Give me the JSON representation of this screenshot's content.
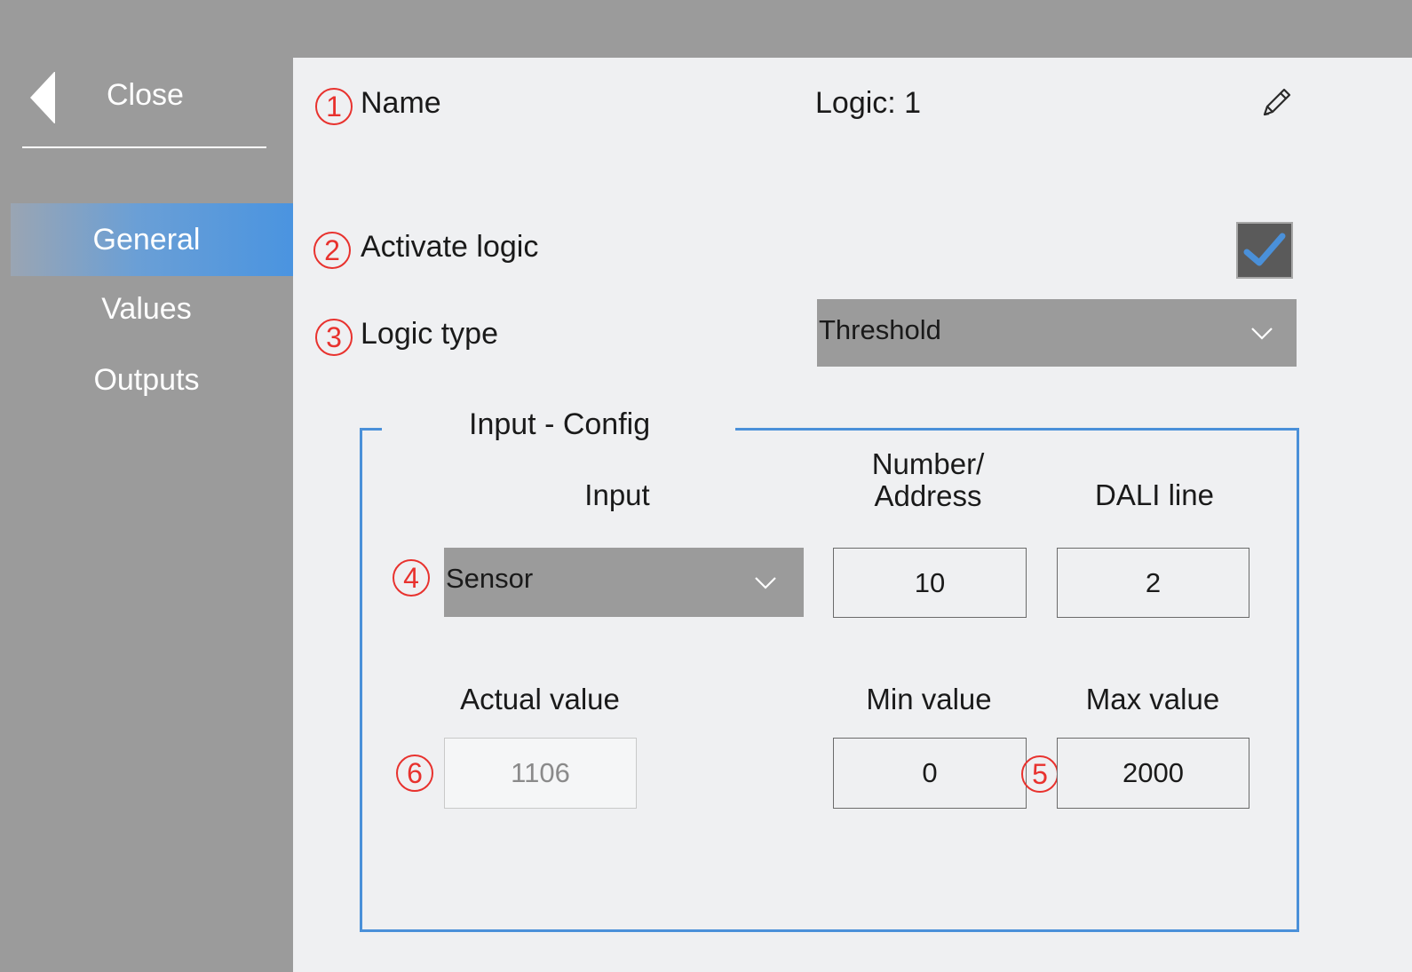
{
  "sidebar": {
    "close_label": "Close",
    "items": [
      {
        "label": "General",
        "active": true
      },
      {
        "label": "Values",
        "active": false
      },
      {
        "label": "Outputs",
        "active": false
      }
    ]
  },
  "colors": {
    "sidebar_bg": "#9b9b9b",
    "panel_bg": "#eff0f2",
    "accent": "#4a94e0",
    "badge": "#e8322e",
    "frame": "#4a90d9"
  },
  "form": {
    "name": {
      "badge": "1",
      "label": "Name",
      "value": "Logic: 1",
      "icon": "pencil-icon"
    },
    "activate": {
      "badge": "2",
      "label": "Activate logic",
      "checked": true
    },
    "logic_type": {
      "badge": "3",
      "label": "Logic type",
      "selected": "Threshold"
    },
    "input_config": {
      "title": "Input - Config",
      "headers": {
        "input": "Input",
        "number_line1": "Number/",
        "number_line2": "Address",
        "dali_line": "DALI line",
        "actual": "Actual value",
        "min": "Min value",
        "max": "Max value"
      },
      "input_badge": "4",
      "input_selected": "Sensor",
      "number_value": "10",
      "dali_value": "2",
      "actual_badge": "6",
      "actual_value": "1106",
      "min_value": "0",
      "max_badge": "5",
      "max_value": "2000"
    }
  }
}
